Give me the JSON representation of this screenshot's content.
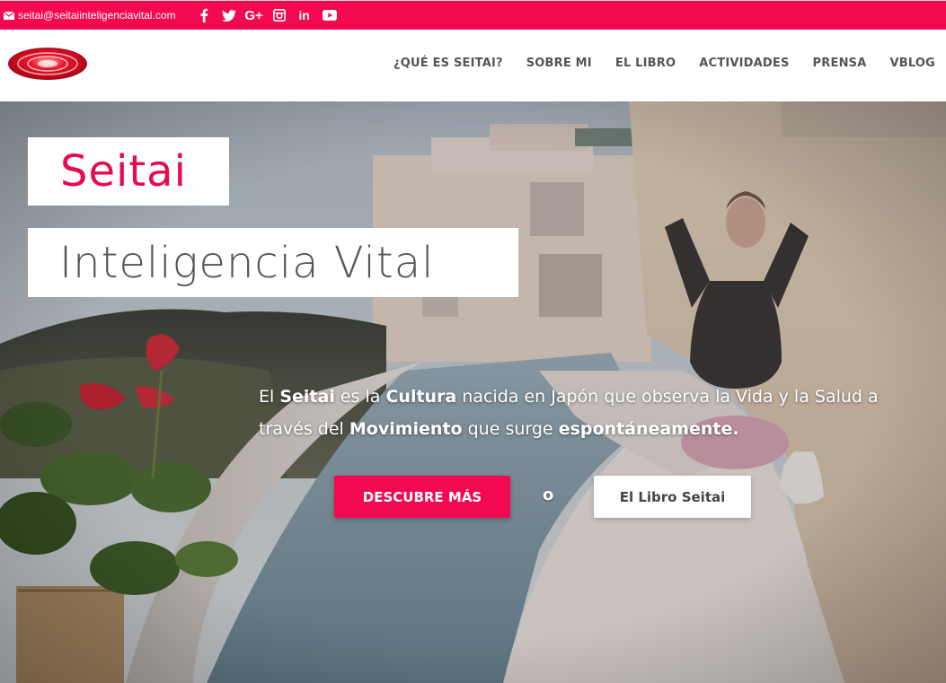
{
  "topbar": {
    "email": "seitai@seitaiinteligenciavital.com",
    "social": [
      {
        "name": "facebook-icon",
        "glyph": "f"
      },
      {
        "name": "twitter-icon",
        "glyph": "t"
      },
      {
        "name": "google-plus-icon",
        "glyph": "G+"
      },
      {
        "name": "instagram-icon",
        "glyph": "◎"
      },
      {
        "name": "linkedin-icon",
        "glyph": "in"
      },
      {
        "name": "youtube-icon",
        "glyph": "▶"
      }
    ]
  },
  "nav": {
    "items": [
      "¿QUÉ ES SEITAI?",
      "SOBRE MI",
      "EL LIBRO",
      "ACTIVIDADES",
      "PRENSA",
      "VBLOG"
    ]
  },
  "hero": {
    "title_line1": "Seitai",
    "title_line2": "Inteligencia Vital",
    "lead": {
      "p1": "El ",
      "b1": "Seitai",
      "p2": " es la ",
      "b2": "Cultura",
      "p3": " nacida en Japón que observa la Vida y la Salud a través del ",
      "b3": "Movimiento",
      "p4": " que surge ",
      "b4": "espontáneamente."
    },
    "primary_button": "DESCUBRE MÁS",
    "or_text": "o",
    "secondary_button": "El Libro Seitai"
  },
  "colors": {
    "brand": "#f2094f",
    "title_pink": "#e80a4e",
    "nav_text": "#555555"
  }
}
